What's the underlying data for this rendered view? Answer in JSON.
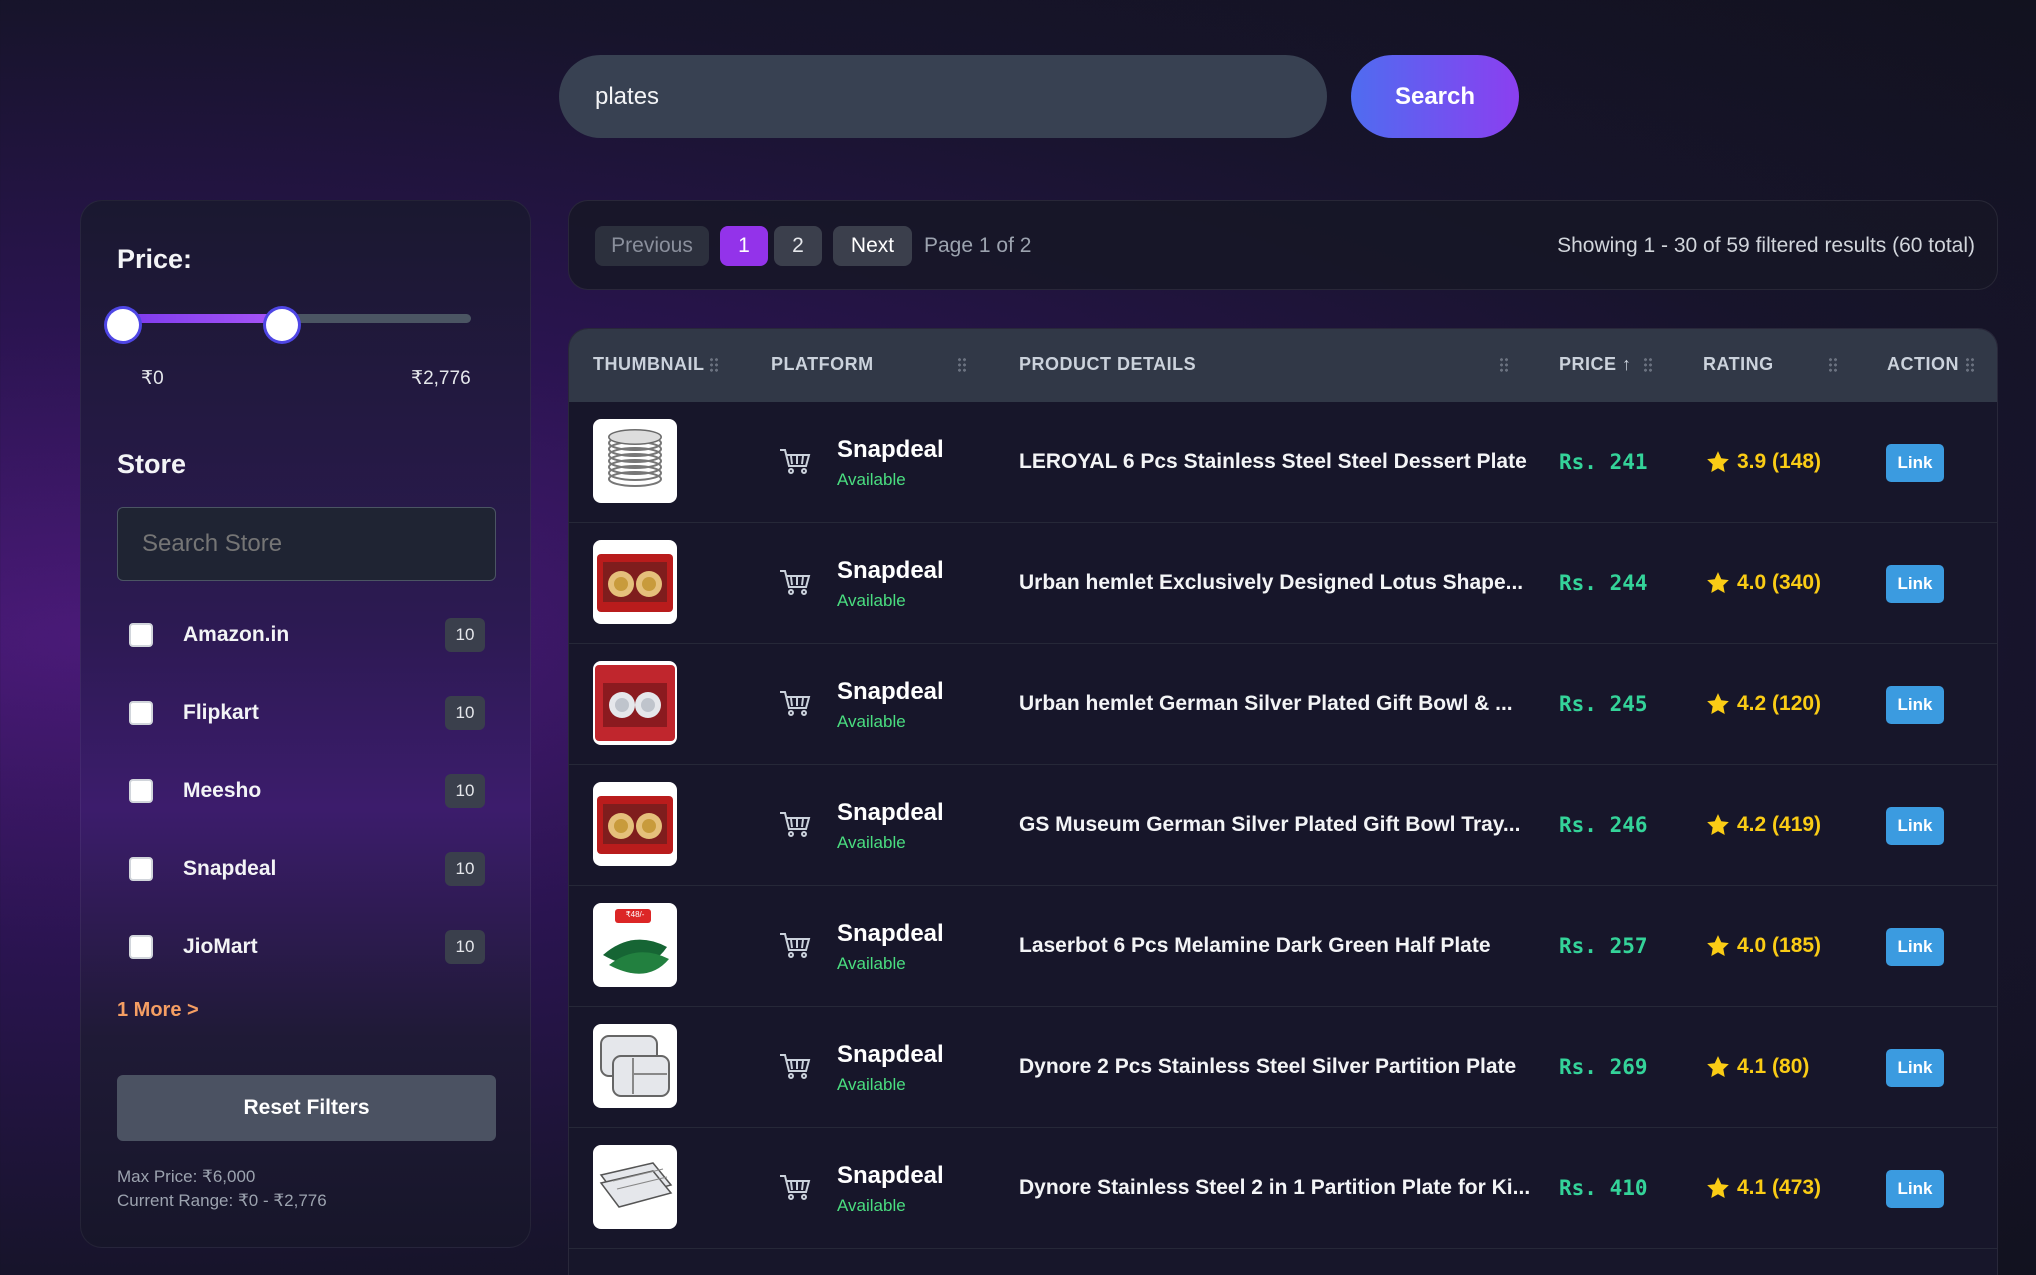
{
  "search": {
    "value": "plates",
    "button_label": "Search"
  },
  "sidebar": {
    "price_title": "Price:",
    "price_min_label": "₹0",
    "price_max_label": "₹2,776",
    "price_low_fraction": 0.0,
    "price_high_fraction": 0.4627,
    "store_title": "Store",
    "store_search_placeholder": "Search Store",
    "stores": [
      {
        "label": "Amazon.in",
        "count": "10"
      },
      {
        "label": "Flipkart",
        "count": "10"
      },
      {
        "label": "Meesho",
        "count": "10"
      },
      {
        "label": "Snapdeal",
        "count": "10"
      },
      {
        "label": "JioMart",
        "count": "10"
      }
    ],
    "more_label": "1 More >",
    "reset_label": "Reset Filters",
    "max_price_note": "Max Price: ₹6,000",
    "current_range_note": "Current Range: ₹0 - ₹2,776"
  },
  "pagination": {
    "prev_label": "Previous",
    "page1": "1",
    "page2": "2",
    "next_label": "Next",
    "page_info": "Page 1 of 2",
    "summary": "Showing 1 - 30 of 59 filtered results (60 total)"
  },
  "table": {
    "headers": {
      "thumbnail": "THUMBNAIL",
      "platform": "PLATFORM",
      "details": "PRODUCT DETAILS",
      "price": "PRICE ↑",
      "rating": "RATING",
      "action": "ACTION"
    },
    "rows": [
      {
        "platform": "Snapdeal",
        "status": "Available",
        "title": "LEROYAL 6 Pcs Stainless Steel Steel Dessert Plate",
        "price": "Rs. 241",
        "rating": "3.9 (148)",
        "action": "Link",
        "thumb_icon": "stacked-steel-plates"
      },
      {
        "platform": "Snapdeal",
        "status": "Available",
        "title": "Urban hemlet Exclusively Designed Lotus Shape...",
        "price": "Rs. 244",
        "rating": "4.0 (340)",
        "action": "Link",
        "thumb_icon": "gift-bowl-red-box"
      },
      {
        "platform": "Snapdeal",
        "status": "Available",
        "title": "Urban hemlet German Silver Plated Gift Bowl & ...",
        "price": "Rs. 245",
        "rating": "4.2 (120)",
        "action": "Link",
        "thumb_icon": "silver-bowl-red-box"
      },
      {
        "platform": "Snapdeal",
        "status": "Available",
        "title": "GS Museum German Silver Plated Gift Bowl Tray...",
        "price": "Rs. 246",
        "rating": "4.2 (419)",
        "action": "Link",
        "thumb_icon": "gift-bowl-red-box"
      },
      {
        "platform": "Snapdeal",
        "status": "Available",
        "title": "Laserbot 6 Pcs Melamine Dark Green Half Plate",
        "price": "Rs. 257",
        "rating": "4.0 (185)",
        "action": "Link",
        "thumb_icon": "green-leaf-plates",
        "thumb_badge": "₹48/-"
      },
      {
        "platform": "Snapdeal",
        "status": "Available",
        "title": "Dynore 2 Pcs Stainless Steel Silver Partition Plate",
        "price": "Rs. 269",
        "rating": "4.1 (80)",
        "action": "Link",
        "thumb_icon": "partition-plates"
      },
      {
        "platform": "Snapdeal",
        "status": "Available",
        "title": "Dynore Stainless Steel 2 in 1 Partition Plate for Ki...",
        "price": "Rs. 410",
        "rating": "4.1 (473)",
        "action": "Link",
        "thumb_icon": "stacked-trays"
      }
    ]
  },
  "colors": {
    "accent_purple": "#9333ea",
    "price_green": "#34d399",
    "rating_yellow": "#facc15",
    "available_green": "#4ade80",
    "link_blue": "#3b9be0",
    "more_orange": "#f59e63"
  }
}
